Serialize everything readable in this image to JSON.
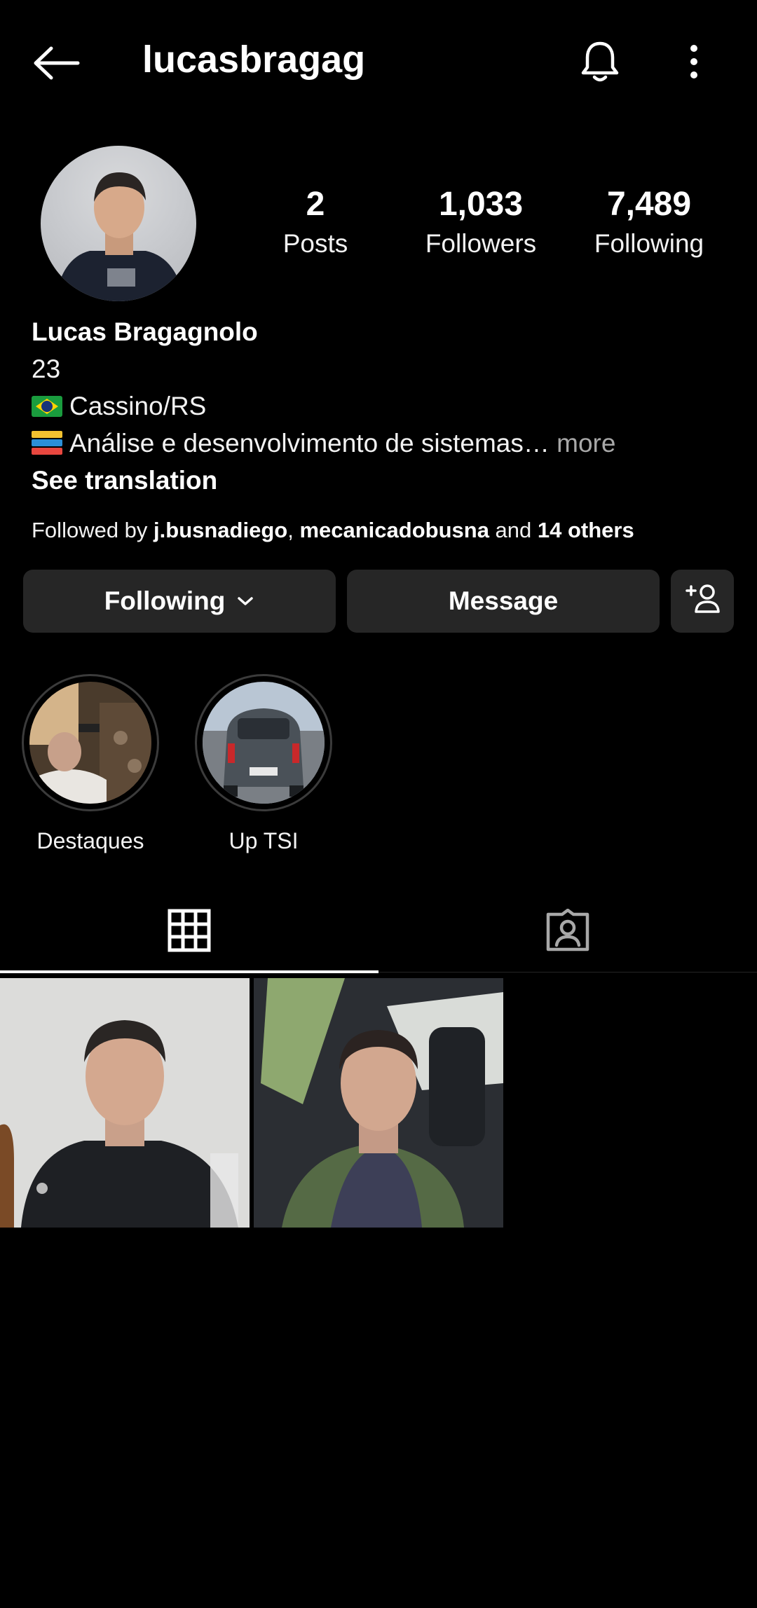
{
  "header": {
    "username": "lucasbragag",
    "back_icon": "back-arrow-icon",
    "notifications_icon": "bell-icon",
    "menu_icon": "more-vertical-icon"
  },
  "stats": [
    {
      "value": "2",
      "label": "Posts"
    },
    {
      "value": "1,033",
      "label": "Followers"
    },
    {
      "value": "7,489",
      "label": "Following"
    }
  ],
  "bio": {
    "name": "Lucas Bragagnolo",
    "line1": "23",
    "line2": "Cassino/RS",
    "line3": "Análise e desenvolvimento de sistemas…",
    "more": "more",
    "see_translation": "See translation"
  },
  "followed_by": {
    "prefix": "Followed by ",
    "user1": "j.busnadiego",
    "sep": ", ",
    "user2": "mecanicadobusna",
    "and": " and ",
    "others": "14 others"
  },
  "buttons": {
    "following": "Following",
    "message": "Message"
  },
  "highlights": [
    {
      "label": "Destaques"
    },
    {
      "label": "Up TSI"
    }
  ],
  "tabs": [
    {
      "icon": "grid-icon",
      "active": true
    },
    {
      "icon": "tagged-icon",
      "active": false
    }
  ],
  "colors": {
    "background": "#000000",
    "button": "#262626",
    "muted": "#a8a8a8"
  }
}
